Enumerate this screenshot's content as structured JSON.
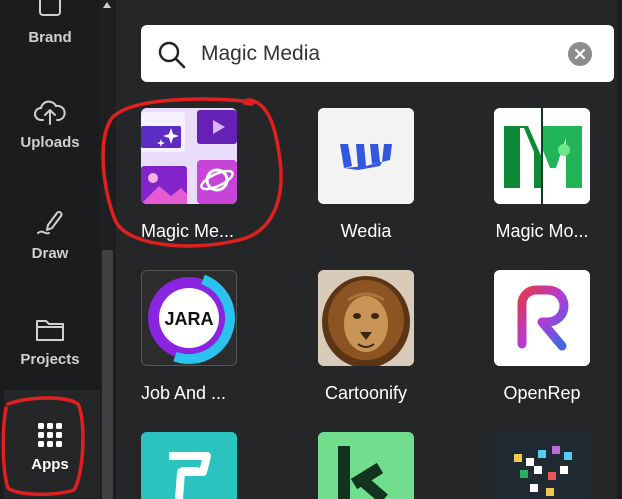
{
  "sidebar": {
    "items": [
      {
        "label": "Brand",
        "icon": "brand-icon"
      },
      {
        "label": "Uploads",
        "icon": "upload-cloud-icon"
      },
      {
        "label": "Draw",
        "icon": "draw-pen-icon"
      },
      {
        "label": "Projects",
        "icon": "folder-icon"
      },
      {
        "label": "Apps",
        "icon": "apps-grid-icon",
        "active": true
      }
    ]
  },
  "search": {
    "value": "Magic Media",
    "placeholder": "Search"
  },
  "apps": [
    {
      "label": "Magic Me...",
      "icon": "magic-media-app-icon"
    },
    {
      "label": "Wedia",
      "icon": "wedia-app-icon"
    },
    {
      "label": "Magic Mo...",
      "icon": "magic-morph-app-icon"
    },
    {
      "label": "Job And ...",
      "icon": "jara-app-icon",
      "icon_text": "JARA"
    },
    {
      "label": "Cartoonify",
      "icon": "cartoonify-lion-app-icon"
    },
    {
      "label": "OpenRep",
      "icon": "openrep-app-icon"
    },
    {
      "label": "",
      "icon": "teal-app-icon"
    },
    {
      "label": "",
      "icon": "green-k-app-icon"
    },
    {
      "label": "",
      "icon": "pixel-app-icon"
    }
  ],
  "colors": {
    "background": "#252627",
    "rail": "#1b1c1d",
    "annotation": "#e0201f"
  }
}
